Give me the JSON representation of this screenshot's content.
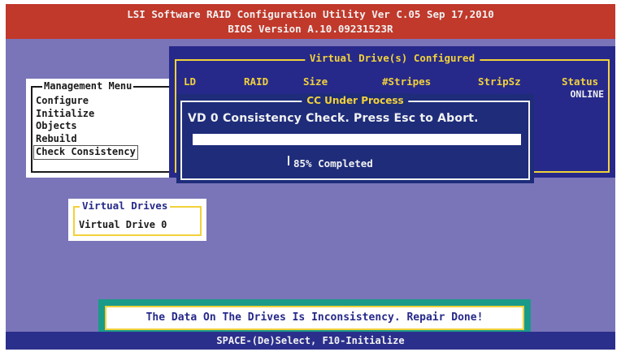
{
  "title_bar": {
    "line1": "LSI Software RAID Configuration Utility Ver C.05 Sep 17,2010",
    "line2": "BIOS Version  A.10.09231523R"
  },
  "management_menu": {
    "title": "Management Menu",
    "items": [
      "Configure",
      "Initialize",
      "Objects",
      "Rebuild",
      "Check Consistency"
    ],
    "selected_index": 4
  },
  "virtual_drives_configured": {
    "title": "Virtual Drive(s) Configured",
    "columns": [
      "LD",
      "RAID",
      "Size",
      "#Stripes",
      "StripSz",
      "Status"
    ],
    "status_value": "ONLINE"
  },
  "cc_dialog": {
    "title": "CC Under Process",
    "message": "VD 0 Consistency Check. Press Esc to Abort.",
    "progress_percent": 85,
    "progress_text": "85% Completed"
  },
  "virtual_drives": {
    "title": "Virtual Drives",
    "items": [
      "Virtual Drive 0"
    ]
  },
  "message_box": {
    "text": "The Data On The Drives Is Inconsistency. Repair Done!"
  },
  "status_bar": {
    "text": "SPACE-(De)Select, F10-Initialize"
  },
  "colors": {
    "background": "#7a75b8",
    "title_bar": "#c0392b",
    "dialog_blue": "#26298a",
    "accent_yellow": "#f2d13a",
    "message_box_teal": "#1a9b8a"
  }
}
